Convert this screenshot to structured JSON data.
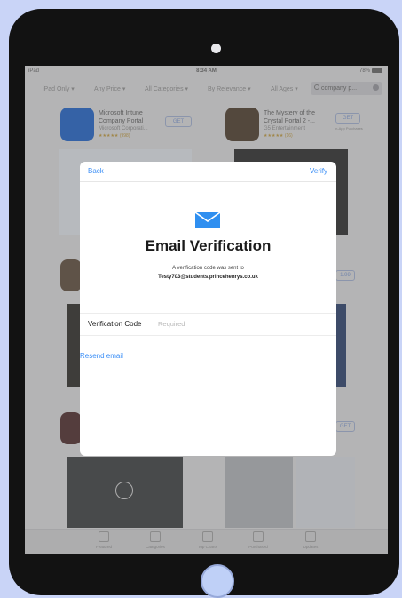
{
  "status_bar": {
    "device": "iPad",
    "time": "8:34 AM",
    "battery": "78%"
  },
  "filters": {
    "device": "iPad Only ▾",
    "price": "Any Price ▾",
    "categories": "All Categories ▾",
    "sort": "By Relevance ▾",
    "ages": "All Ages ▾"
  },
  "search": {
    "query": "company p..."
  },
  "background_apps": [
    {
      "name": "Microsoft Intune Company Portal",
      "developer": "Microsoft Corporati...",
      "rating_count": "(998)",
      "button": "GET"
    },
    {
      "name": "The Mystery of the Crystal Portal 2 -...",
      "developer": "G5 Entertainment",
      "rating_count": "(16)",
      "button": "GET",
      "button_note": "In-App Purchases"
    }
  ],
  "background_price": "1.99",
  "background_get": "GET",
  "tabbar": [
    "Featured",
    "Categories",
    "Top Charts",
    "Purchased",
    "Updates"
  ],
  "modal": {
    "back_label": "Back",
    "verify_label": "Verify",
    "title": "Email Verification",
    "subtitle": "A verification code was sent to",
    "email": "Testy703@students.princehenrys.co.uk",
    "field_label": "Verification Code",
    "field_placeholder": "Required",
    "resend_label": "Resend email"
  },
  "colors": {
    "accent": "#3a8ef6",
    "device": "#121212",
    "page_bg": "#c9d4f7"
  }
}
